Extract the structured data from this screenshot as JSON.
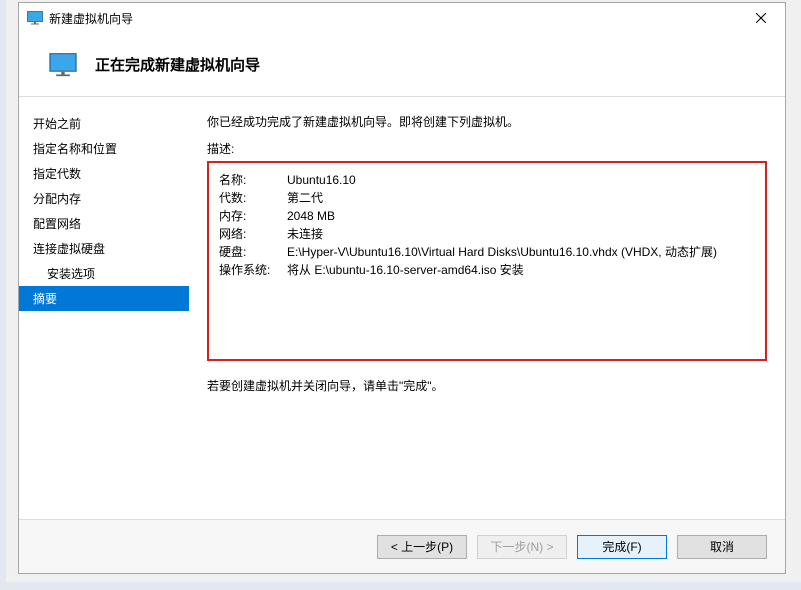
{
  "window": {
    "title": "新建虚拟机向导"
  },
  "header": {
    "title": "正在完成新建虚拟机向导"
  },
  "sidebar": {
    "steps": [
      {
        "label": "开始之前",
        "indent": false
      },
      {
        "label": "指定名称和位置",
        "indent": false
      },
      {
        "label": "指定代数",
        "indent": false
      },
      {
        "label": "分配内存",
        "indent": false
      },
      {
        "label": "配置网络",
        "indent": false
      },
      {
        "label": "连接虚拟硬盘",
        "indent": false
      },
      {
        "label": "安装选项",
        "indent": true
      },
      {
        "label": "摘要",
        "indent": false,
        "selected": true
      }
    ]
  },
  "content": {
    "intro": "你已经成功完成了新建虚拟机向导。即将创建下列虚拟机。",
    "desc_label": "描述:",
    "summary": {
      "name_label": "名称:",
      "name_value": "Ubuntu16.10",
      "gen_label": "代数:",
      "gen_value": "第二代",
      "mem_label": "内存:",
      "mem_value": "2048 MB",
      "net_label": "网络:",
      "net_value": "未连接",
      "disk_label": "硬盘:",
      "disk_value": "E:\\Hyper-V\\Ubuntu16.10\\Virtual Hard Disks\\Ubuntu16.10.vhdx (VHDX, 动态扩展)",
      "os_label": "操作系统:",
      "os_value": "将从 E:\\ubuntu-16.10-server-amd64.iso 安装"
    },
    "closing": "若要创建虚拟机并关闭向导，请单击\"完成\"。"
  },
  "footer": {
    "prev": "< 上一步(P)",
    "next": "下一步(N) >",
    "finish": "完成(F)",
    "cancel": "取消"
  }
}
